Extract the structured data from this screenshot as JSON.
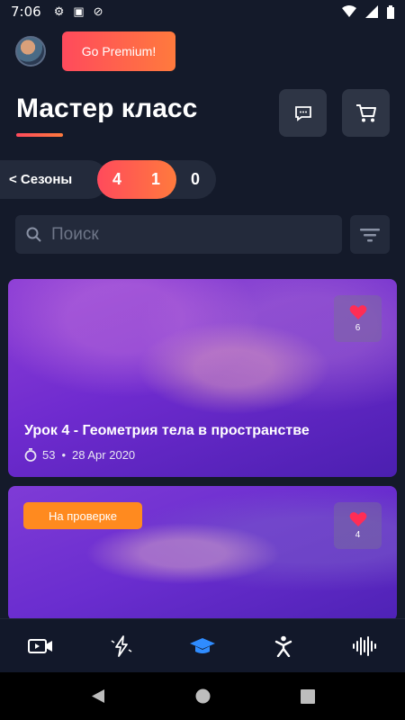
{
  "status_bar": {
    "time": "7:06"
  },
  "header": {
    "premium_label": "Go Premium!"
  },
  "page": {
    "title": "Мастер класс"
  },
  "seasons": {
    "back_label": "< Сезоны",
    "counts": [
      "4",
      "1",
      "0"
    ]
  },
  "search": {
    "placeholder": "Поиск",
    "value": ""
  },
  "cards": [
    {
      "title": "Урок 4 - Геометрия тела в пространстве",
      "views": "53",
      "date": "28 Apr 2020",
      "likes": "6"
    },
    {
      "badge": "На проверке",
      "likes": "4"
    }
  ],
  "bottom_nav": {
    "items": [
      {
        "icon": "video-icon"
      },
      {
        "icon": "lightning-icon"
      },
      {
        "icon": "graduation-cap-icon",
        "active": true
      },
      {
        "icon": "person-icon"
      },
      {
        "icon": "sound-wave-icon"
      }
    ]
  },
  "colors": {
    "accent": "#ff5a4e",
    "accent_end": "#ff7a3d",
    "active_nav": "#2f8cff",
    "badge": "#ff8a1f",
    "heart": "#ff2d55",
    "background": "#141a2a"
  }
}
